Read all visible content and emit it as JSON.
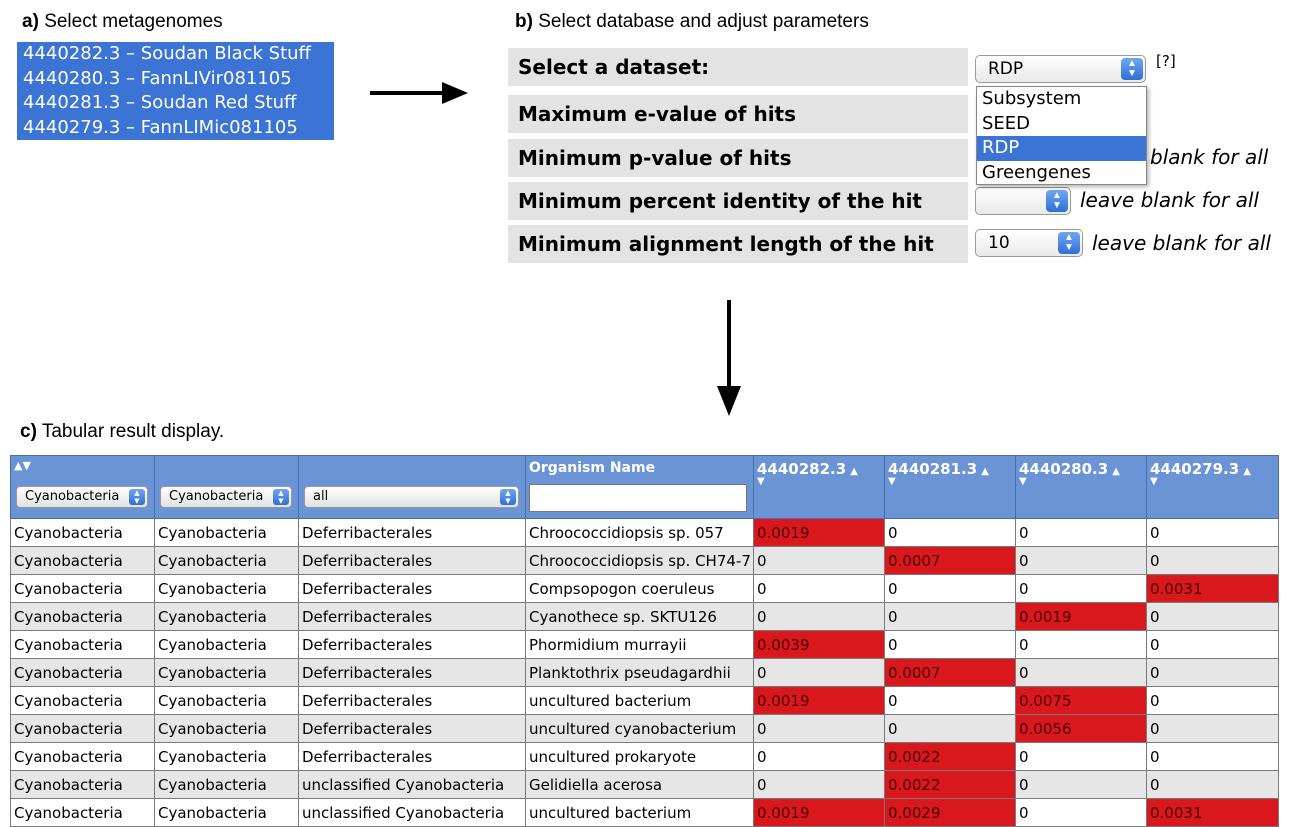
{
  "panel_a": {
    "prefix": "a)",
    "title": "Select metagenomes",
    "metagenomes": [
      "4440282.3 – Soudan Black Stuff",
      "4440280.3 – FannLIVir081105",
      "4440281.3 – Soudan Red Stuff",
      "4440279.3 – FannLIMic081105"
    ]
  },
  "panel_b": {
    "prefix": "b)",
    "title": "Select database and adjust parameters",
    "help_link": "[?]",
    "rows": [
      {
        "label": "Select a dataset:",
        "value": "RDP",
        "hint": ""
      },
      {
        "label": "Maximum e-value of hits",
        "value": "",
        "hint": ""
      },
      {
        "label": "Minimum p-value of hits",
        "value": "",
        "hint": "blank for all"
      },
      {
        "label": "Minimum percent identity of the hit",
        "value": "",
        "hint": "leave blank for all"
      },
      {
        "label": "Minimum alignment length of the hit",
        "value": "10",
        "hint": "leave blank for all"
      }
    ],
    "dataset_options": [
      "Subsystem",
      "SEED",
      "RDP",
      "Greengenes"
    ],
    "dataset_selected": "RDP"
  },
  "panel_c": {
    "prefix": "c)",
    "title": "Tabular result display.",
    "filters": [
      "Cyanobacteria",
      "Cyanobacteria",
      "all"
    ],
    "organism_header": "Organism Name",
    "metagenome_headers": [
      "4440282.3",
      "4440281.3",
      "4440280.3",
      "4440279.3"
    ],
    "rows": [
      [
        "Cyanobacteria",
        "Cyanobacteria",
        "Deferribacterales",
        "Chroococcidiopsis sp. 057",
        "0.0019",
        "0",
        "0",
        "0"
      ],
      [
        "Cyanobacteria",
        "Cyanobacteria",
        "Deferribacterales",
        "Chroococcidiopsis sp. CH74-7",
        "0",
        "0.0007",
        "0",
        "0"
      ],
      [
        "Cyanobacteria",
        "Cyanobacteria",
        "Deferribacterales",
        "Compsopogon coeruleus",
        "0",
        "0",
        "0",
        "0.0031"
      ],
      [
        "Cyanobacteria",
        "Cyanobacteria",
        "Deferribacterales",
        "Cyanothece sp. SKTU126",
        "0",
        "0",
        "0.0019",
        "0"
      ],
      [
        "Cyanobacteria",
        "Cyanobacteria",
        "Deferribacterales",
        "Phormidium murrayii",
        "0.0039",
        "0",
        "0",
        "0"
      ],
      [
        "Cyanobacteria",
        "Cyanobacteria",
        "Deferribacterales",
        "Planktothrix pseudagardhii",
        "0",
        "0.0007",
        "0",
        "0"
      ],
      [
        "Cyanobacteria",
        "Cyanobacteria",
        "Deferribacterales",
        "uncultured bacterium",
        "0.0019",
        "0",
        "0.0075",
        "0"
      ],
      [
        "Cyanobacteria",
        "Cyanobacteria",
        "Deferribacterales",
        "uncultured cyanobacterium",
        "0",
        "0",
        "0.0056",
        "0"
      ],
      [
        "Cyanobacteria",
        "Cyanobacteria",
        "Deferribacterales",
        "uncultured prokaryote",
        "0",
        "0.0022",
        "0",
        "0"
      ],
      [
        "Cyanobacteria",
        "Cyanobacteria",
        "unclassified Cyanobacteria",
        "Gelidiella acerosa",
        "0",
        "0.0022",
        "0",
        "0"
      ],
      [
        "Cyanobacteria",
        "Cyanobacteria",
        "unclassified Cyanobacteria",
        "uncultured bacterium",
        "0.0019",
        "0.0029",
        "0",
        "0.0031"
      ]
    ]
  },
  "colors": {
    "selection_blue": "#3b74d4",
    "header_blue": "#6b94d6",
    "hit_red": "#d9181e"
  }
}
